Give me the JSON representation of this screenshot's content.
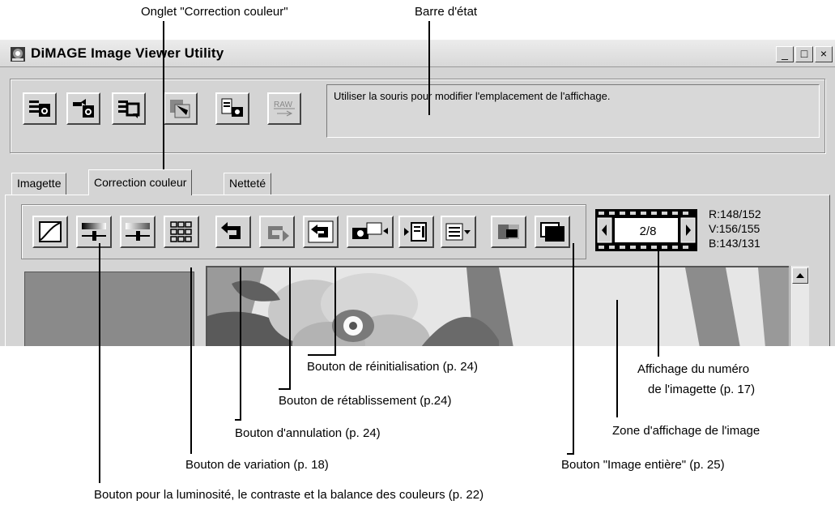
{
  "annotations_top": {
    "color_correction_tab": "Onglet \"Correction couleur\"",
    "status_bar": "Barre d'état"
  },
  "window": {
    "title": "DiMAGE Image Viewer Utility",
    "minimize_glyph": "_",
    "maximize_glyph": "□",
    "close_glyph": "×"
  },
  "toolbar": {
    "raw_label": "RAW"
  },
  "status_bar": {
    "text": "Utiliser la souris pour modifier l'emplacement de l'affichage."
  },
  "tabs": [
    {
      "label": "Imagette",
      "active": false
    },
    {
      "label": "Correction couleur",
      "active": true
    },
    {
      "label": "Netteté",
      "active": false
    }
  ],
  "frame_counter": {
    "current": 2,
    "total": 8,
    "display": "2/8"
  },
  "rgb_readout": {
    "r": "R:148/152",
    "v": "V:156/155",
    "b": "B:143/131"
  },
  "annotations_bottom": {
    "reset_button": "Bouton de réinitialisation (p. 24)",
    "redo_button": "Bouton de rétablissement (p.24)",
    "undo_button": "Bouton d'annulation (p. 24)",
    "variation_button": "Bouton de variation (p. 18)",
    "brightness_button": "Bouton pour la luminosité, le contraste et la balance des couleurs (p. 22)",
    "frame_number_display_line1": "Affichage du numéro",
    "frame_number_display_line2": "de l'imagette (p. 17)",
    "image_display_area": "Zone d'affichage de l'image",
    "full_image_button": "Bouton \"Image entière\" (p. 25)"
  },
  "colors": {
    "window_bg": "#d4d4d4",
    "thumbnail_placeholder": "#8a8a8a",
    "reset_icon_blue": "#3d5fa8"
  }
}
